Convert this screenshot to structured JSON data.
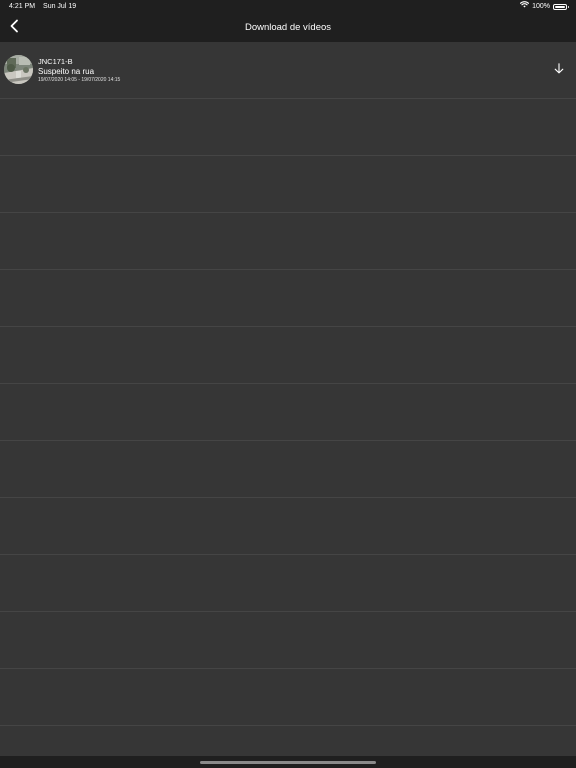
{
  "status_bar": {
    "time": "4:21 PM",
    "date": "Sun Jul 19",
    "battery_text": "100%",
    "battery_level": 1.0,
    "icons": [
      "wifi-icon",
      "battery-icon"
    ]
  },
  "nav": {
    "title": "Download de vídeos",
    "back_icon": "chevron-left-icon"
  },
  "videos": [
    {
      "camera": "JNC171-B",
      "title": "Suspeito na rua",
      "range": "19/07/2020 14:05 - 19/07/2020 14:15",
      "thumbnail_icon": "video-thumbnail",
      "action_icon": "download-arrow-icon"
    }
  ],
  "colors": {
    "background": "#363636",
    "bars": "#1f1f1f",
    "separator": "#454545",
    "text": "#ffffff"
  }
}
